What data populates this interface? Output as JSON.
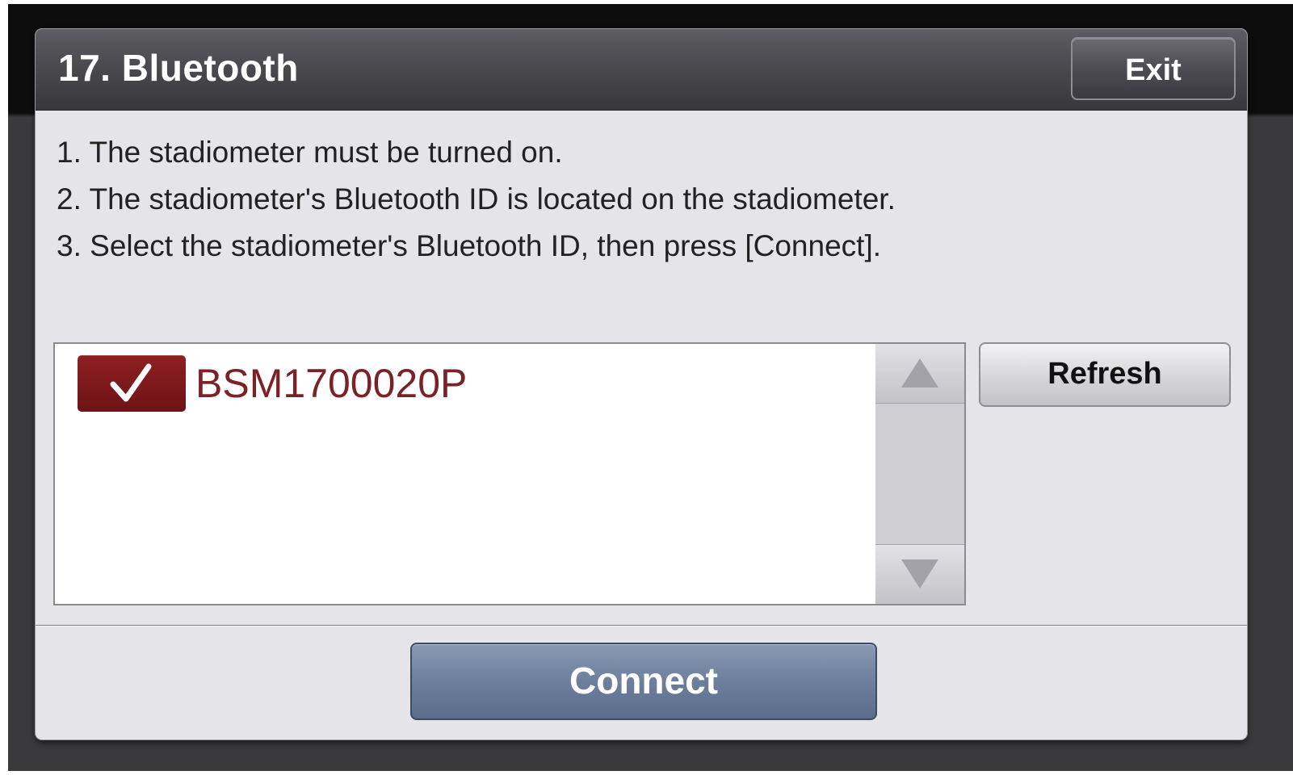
{
  "dialog": {
    "title": "17. Bluetooth",
    "exit_label": "Exit"
  },
  "instructions": [
    "1. The stadiometer must be turned on.",
    "2. The stadiometer's Bluetooth ID is located on the stadiometer.",
    "3. Select the stadiometer's Bluetooth ID, then press [Connect]."
  ],
  "device_list": {
    "items": [
      {
        "label": "BSM1700020P",
        "checked": true
      }
    ],
    "scroll_up_icon": "triangle-up-icon",
    "scroll_down_icon": "triangle-down-icon"
  },
  "buttons": {
    "refresh_label": "Refresh",
    "connect_label": "Connect"
  },
  "colors": {
    "selected_item": "#7a2226",
    "checkbox": "#8e1f22",
    "connect_button": "#6d7f9d"
  }
}
